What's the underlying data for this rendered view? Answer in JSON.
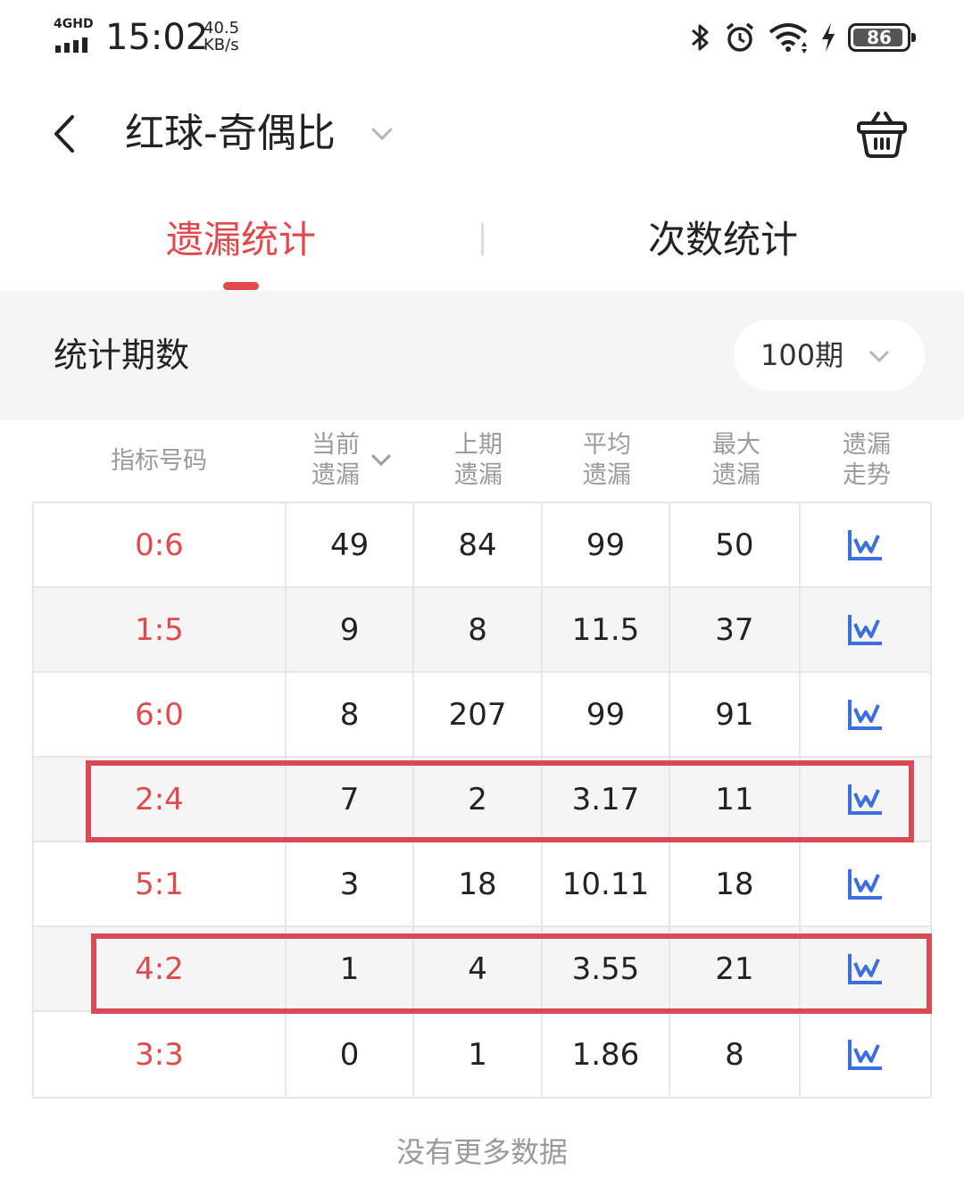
{
  "status_bar": {
    "network": "4GHD",
    "time": "15:02",
    "speed_value": "40.5",
    "speed_unit": "KB/s",
    "battery": "86",
    "icons": [
      "bluetooth-icon",
      "alarm-icon",
      "wifi-icon",
      "charging-icon",
      "battery-icon"
    ]
  },
  "header": {
    "title": "红球-奇偶比",
    "back_icon": "chevron-left-icon",
    "title_caret_icon": "chevron-down-icon",
    "cart_icon": "basket-icon"
  },
  "tabs": [
    {
      "label": "遗漏统计",
      "active": true
    },
    {
      "label": "次数统计",
      "active": false
    }
  ],
  "period": {
    "label": "统计期数",
    "selected": "100期"
  },
  "table": {
    "headers": [
      {
        "line1": "指标号码",
        "line2": ""
      },
      {
        "line1": "当前",
        "line2": "遗漏"
      },
      {
        "line1": "上期",
        "line2": "遗漏"
      },
      {
        "line1": "平均",
        "line2": "遗漏"
      },
      {
        "line1": "最大",
        "line2": "遗漏"
      },
      {
        "line1": "遗漏",
        "line2": "走势"
      }
    ],
    "rows": [
      {
        "ratio": "0:6",
        "current": "49",
        "previous": "84",
        "average": "99",
        "max": "50"
      },
      {
        "ratio": "1:5",
        "current": "9",
        "previous": "8",
        "average": "11.5",
        "max": "37"
      },
      {
        "ratio": "6:0",
        "current": "8",
        "previous": "207",
        "average": "99",
        "max": "91"
      },
      {
        "ratio": "2:4",
        "current": "7",
        "previous": "2",
        "average": "3.17",
        "max": "11"
      },
      {
        "ratio": "5:1",
        "current": "3",
        "previous": "18",
        "average": "10.11",
        "max": "18"
      },
      {
        "ratio": "4:2",
        "current": "1",
        "previous": "4",
        "average": "3.55",
        "max": "21"
      },
      {
        "ratio": "3:3",
        "current": "0",
        "previous": "1",
        "average": "1.86",
        "max": "8"
      }
    ],
    "highlighted_rows": [
      "2:4",
      "4:2"
    ],
    "trend_icon": "line-chart-icon"
  },
  "footer": {
    "no_more": "没有更多数据"
  },
  "colors": {
    "accent": "#e04a4d",
    "highlight_border": "#d84a55",
    "trend_icon": "#3b6fe0",
    "muted_text": "#9a9a9a",
    "grey_band": "#f5f5f5"
  }
}
